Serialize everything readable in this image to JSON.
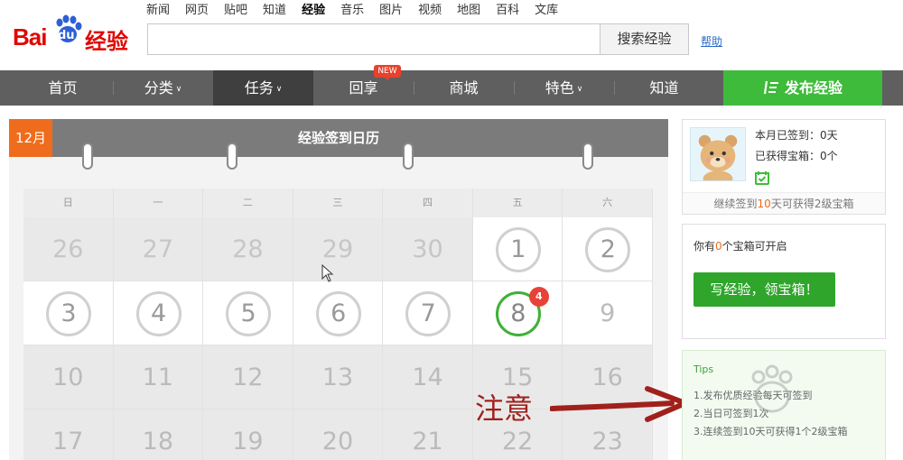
{
  "logo": {
    "bai": "Bai",
    "du": "du",
    "jingyan": "经验"
  },
  "topnav": [
    {
      "label": "新闻",
      "active": false
    },
    {
      "label": "网页",
      "active": false
    },
    {
      "label": "贴吧",
      "active": false
    },
    {
      "label": "知道",
      "active": false
    },
    {
      "label": "经验",
      "active": true
    },
    {
      "label": "音乐",
      "active": false
    },
    {
      "label": "图片",
      "active": false
    },
    {
      "label": "视频",
      "active": false
    },
    {
      "label": "地图",
      "active": false
    },
    {
      "label": "百科",
      "active": false
    },
    {
      "label": "文库",
      "active": false
    }
  ],
  "search": {
    "value": "",
    "button_label": "搜索经验",
    "help_label": "帮助"
  },
  "mainnav": {
    "items": [
      {
        "label": "首页",
        "caret": false,
        "active": false
      },
      {
        "label": "分类",
        "caret": true,
        "active": false
      },
      {
        "label": "任务",
        "caret": true,
        "active": true
      },
      {
        "label": "回享",
        "caret": false,
        "active": false
      },
      {
        "label": "商城",
        "caret": false,
        "active": false
      },
      {
        "label": "特色",
        "caret": true,
        "active": false
      },
      {
        "label": "知道",
        "caret": false,
        "active": false
      }
    ],
    "new_badge": "NEW",
    "publish_label": "发布经验"
  },
  "calendar": {
    "month": "12月",
    "title": "经验签到日历",
    "weekdays": [
      "日",
      "一",
      "二",
      "三",
      "四",
      "五",
      "六"
    ],
    "weeks": [
      [
        {
          "n": "26",
          "state": "past"
        },
        {
          "n": "27",
          "state": "past"
        },
        {
          "n": "28",
          "state": "past"
        },
        {
          "n": "29",
          "state": "past"
        },
        {
          "n": "30",
          "state": "past"
        },
        {
          "n": "1",
          "state": "missed"
        },
        {
          "n": "2",
          "state": "missed"
        }
      ],
      [
        {
          "n": "3",
          "state": "missed"
        },
        {
          "n": "4",
          "state": "missed"
        },
        {
          "n": "5",
          "state": "missed"
        },
        {
          "n": "6",
          "state": "missed"
        },
        {
          "n": "7",
          "state": "missed"
        },
        {
          "n": "8",
          "state": "today",
          "badge": "4"
        },
        {
          "n": "9",
          "state": "future"
        }
      ],
      [
        {
          "n": "10",
          "state": "future"
        },
        {
          "n": "11",
          "state": "future"
        },
        {
          "n": "12",
          "state": "future"
        },
        {
          "n": "13",
          "state": "future"
        },
        {
          "n": "14",
          "state": "future"
        },
        {
          "n": "15",
          "state": "future"
        },
        {
          "n": "16",
          "state": "future"
        }
      ],
      [
        {
          "n": "17",
          "state": "future"
        },
        {
          "n": "18",
          "state": "future"
        },
        {
          "n": "19",
          "state": "future"
        },
        {
          "n": "20",
          "state": "future"
        },
        {
          "n": "21",
          "state": "future"
        },
        {
          "n": "22",
          "state": "future"
        },
        {
          "n": "23",
          "state": "future"
        }
      ]
    ]
  },
  "annotation": {
    "text": "注意"
  },
  "signin_card": {
    "signed_label": "本月已签到：0天",
    "chests_label": "已获得宝箱：0个",
    "footer_pre": "继续签到",
    "footer_days": "10",
    "footer_post": "天可获得2级宝箱"
  },
  "chest_card": {
    "pre": "你有",
    "count": "0",
    "post": "个宝箱可开启",
    "button_label": "写经验，领宝箱！"
  },
  "tips_card": {
    "title": "Tips",
    "items": [
      "1.发布优质经验每天可签到",
      "2.当日可签到1次",
      "3.连续签到10天可获得1个2级宝箱"
    ]
  },
  "colors": {
    "accent_green": "#3fbb3b",
    "brand_red": "#e10602",
    "month_orange": "#ef6c1c"
  }
}
